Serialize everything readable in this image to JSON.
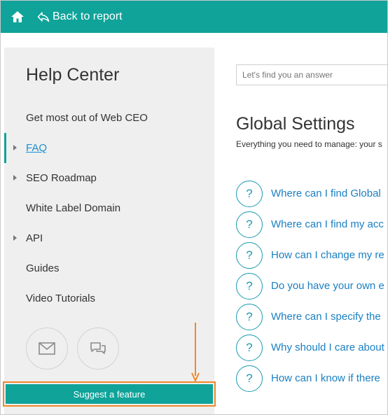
{
  "topbar": {
    "home_icon": "home-icon",
    "back_label": "Back to report",
    "back_icon": "reply-arrow-icon",
    "color": "#0fa39a"
  },
  "sidebar": {
    "title": "Help Center",
    "items": [
      {
        "label": "Get most out of Web CEO",
        "expandable": false,
        "active": false
      },
      {
        "label": "FAQ",
        "expandable": true,
        "active": true
      },
      {
        "label": "SEO Roadmap",
        "expandable": true,
        "active": false
      },
      {
        "label": "White Label Domain",
        "expandable": false,
        "active": false
      },
      {
        "label": "API",
        "expandable": true,
        "active": false
      },
      {
        "label": "Guides",
        "expandable": false,
        "active": false
      },
      {
        "label": "Video Tutorials",
        "expandable": false,
        "active": false
      }
    ],
    "contact_icons": [
      "envelope-icon",
      "chat-bubbles-icon"
    ],
    "suggest_label": "Suggest a feature",
    "highlight_color": "#f0892b"
  },
  "search": {
    "placeholder": "Let's find you an answer"
  },
  "main": {
    "title": "Global Settings",
    "subtitle": "Everything you need to manage: your s",
    "questions": [
      "Where can I find Global",
      "Where can I find my acc",
      "How can I change my re",
      "Do you have your own e",
      "Where can I specify the",
      "Why should I care about",
      "How can I know if there"
    ],
    "question_icon": "?"
  }
}
